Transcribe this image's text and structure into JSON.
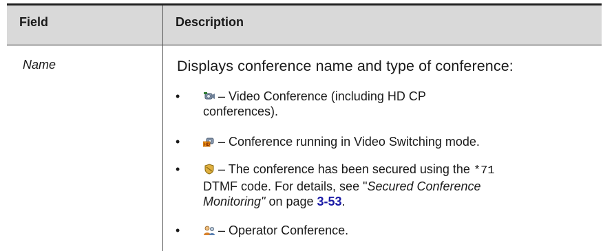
{
  "table": {
    "header": {
      "field": "Field",
      "description": "Description"
    },
    "row": {
      "field": "Name",
      "intro": "Displays conference name and type of conference:",
      "bullets": [
        {
          "icon": "video-conference-icon",
          "dash": "–",
          "line1": "Video Conference (including HD CP",
          "line2": "conferences)."
        },
        {
          "icon": "video-switching-icon",
          "dash": "–",
          "text": "Conference running in Video Switching mode."
        },
        {
          "icon": "secured-shield-icon",
          "dash": "–",
          "pre": "The conference has been secured using the",
          "code": "*71",
          "line2_pre": "DTMF code. For details, see \"",
          "ref_italic": "Secured Conference",
          "line3_italic": "Monitoring\"",
          "on_page": " on page ",
          "page": "3-53",
          "end": "."
        },
        {
          "icon": "operator-conference-icon",
          "dash": "–",
          "text": "Operator Conference."
        }
      ]
    }
  },
  "colors": {
    "header_bg": "#d9d9d9",
    "link": "#1a1aa6",
    "rule": "#1f1f1f"
  }
}
